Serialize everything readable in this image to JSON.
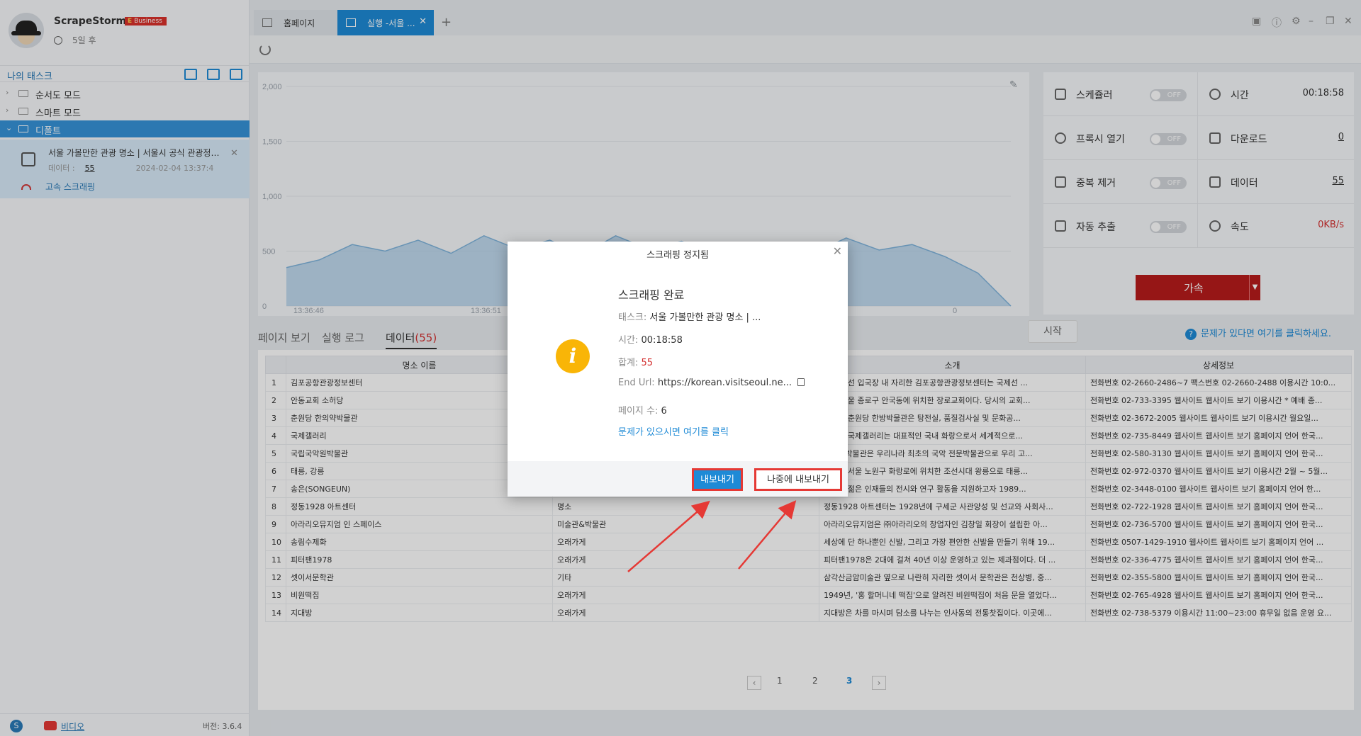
{
  "app": {
    "name": "ScrapeStorm",
    "plan_badge": "Business",
    "plan_badge_prefix": "E",
    "expiry": "5일 후"
  },
  "sidebar": {
    "my_tasks_label": "나의 태스크",
    "tree": [
      {
        "label": "순서도 모드",
        "active": false
      },
      {
        "label": "스마트 모드",
        "active": false
      },
      {
        "label": "디폴트",
        "active": true
      }
    ],
    "task": {
      "title": "서울 가볼만한 관광 명소 | 서울시 공식 관광정보 웹사이트",
      "data_label": "데이터 :",
      "data_count": "55",
      "date": "2024-02-04 13:37:4",
      "speed_label": "고속 스크래핑"
    },
    "footer": {
      "video_label": "비디오",
      "version": "버전: 3.6.4"
    }
  },
  "tabs": [
    {
      "label": "홈페이지"
    },
    {
      "label": "실행 -서울 ..."
    }
  ],
  "chart_data": {
    "type": "area",
    "x": [
      "13:36:46",
      "13:36:51",
      "0"
    ],
    "yticks": [
      0,
      500,
      1000,
      1500,
      2000
    ],
    "ylim": [
      0,
      2000
    ],
    "color": "#a9cde8",
    "values": [
      350,
      420,
      560,
      500,
      600,
      480,
      640,
      520,
      600,
      470,
      640,
      520,
      590,
      480,
      500,
      560,
      480,
      620,
      510,
      560,
      450,
      300,
      0
    ]
  },
  "stats": {
    "scheduler": {
      "label": "스케쥴러",
      "toggle": "OFF"
    },
    "time": {
      "label": "시간",
      "value": "00:18:58"
    },
    "proxy": {
      "label": "프록시 열기",
      "toggle": "OFF"
    },
    "download": {
      "label": "다운로드",
      "value": "0"
    },
    "dedupe": {
      "label": "중복 제거",
      "toggle": "OFF"
    },
    "data": {
      "label": "데이터",
      "value": "55"
    },
    "auto": {
      "label": "자동 추출",
      "toggle": "OFF"
    },
    "speed": {
      "label": "속도",
      "value": "0KB/s"
    },
    "accelerate": "가속"
  },
  "subtabs": {
    "page_view": "페이지 보기",
    "run_log": "실행 로그",
    "data": "데이터",
    "data_count": "(55)"
  },
  "start_button": "시작",
  "help_link": "문제가 있다면 여기를 클릭하세요.",
  "table": {
    "headers": [
      "",
      "명소 이름",
      "",
      "소개",
      "상세정보"
    ],
    "rows": [
      [
        "1",
        "김포공항관광정보센터",
        "",
        "항 국제선 입국장 내 자리한 김포공항관광정보센터는 국제선 ...",
        "전화번호 02-2660-2486~7 팩스번호 02-2660-2488 이용시간 10:0..."
      ],
      [
        "2",
        "안동교회 소허당",
        "",
        "되는 서울 종로구 안국동에 위치한 장로교회이다. 당시의 교회...",
        "전화번호 02-733-3395 웹사이트 웹사이트 보기 이용시간 * 예배 종..."
      ],
      [
        "3",
        "춘원당 한의약박물관",
        "",
        "개관한 춘원당 한방박물관은 탕전실, 품질검사실 및 문화공...",
        "전화번호 02-3672-2005 웹사이트 웹사이트 보기 이용시간 월요일..."
      ],
      [
        "4",
        "국제갤러리",
        "",
        "개관한 국제갤러리는 대표적인 국내 화랑으로서 세계적으로...",
        "전화번호 02-735-8449 웹사이트 웹사이트 보기 홈페이지 언어 한국..."
      ],
      [
        "5",
        "국립국악원박물관",
        "",
        "국악원박물관은 우리나라 최초의 국악 전문박물관으로 우리 고...",
        "전화번호 02-580-3130 웹사이트 웹사이트 보기 홈페이지 언어 한국..."
      ],
      [
        "6",
        "태릉, 강릉",
        "",
        "강릉은 서울 노원구 화랑로에 위치한 조선시대 왕릉으로 태릉...",
        "전화번호 02-972-0370 웹사이트 웹사이트 보기 이용시간 2월 ~ 5월..."
      ],
      [
        "7",
        "송은(SONGEUN)",
        "",
        "미술계 젊은 인재들의 전시와 연구 활동을 지원하고자 1989...",
        "전화번호 02-3448-0100 웹사이트 웹사이트 보기 홈페이지 언어 한..."
      ],
      [
        "8",
        "정동1928 아트센터",
        "명소",
        "정동1928 아트센터는 1928년에 구세군 사관양성 및 선교와 사회사...",
        "전화번호 02-722-1928 웹사이트 웹사이트 보기 홈페이지 언어 한국..."
      ],
      [
        "9",
        "아라리오뮤지엄 인 스페이스",
        "미술관&박물관",
        "아라리오뮤지엄은 ㈜아라리오의 창업자인 김창일 회장이 설립한 아...",
        "전화번호 02-736-5700 웹사이트 웹사이트 보기 홈페이지 언어 한국..."
      ],
      [
        "10",
        "송림수제화",
        "오래가게",
        "세상에 단 하나뿐인 신발, 그리고 가장 편안한 신발을 만들기 위해 19...",
        "전화번호 0507-1429-1910 웹사이트 웹사이트 보기 홈페이지 언어 ..."
      ],
      [
        "11",
        "피터팬1978",
        "오래가게",
        "피터팬1978은 2대에 걸쳐 40년 이상 운영하고 있는 제과점이다. 더 ...",
        "전화번호 02-336-4775 웹사이트 웹사이트 보기 홈페이지 언어 한국..."
      ],
      [
        "12",
        "셋이서문학관",
        "기타",
        "삼각산금암미술관 옆으로 나란히 자리한 셋이서 문학관은 천상병, 중...",
        "전화번호 02-355-5800 웹사이트 웹사이트 보기 홈페이지 언어 한국..."
      ],
      [
        "13",
        "비원떡집",
        "오래가게",
        "1949년, '홍 할머니네 떡집'으로 알려진 비원떡집이 처음 문을 열었다...",
        "전화번호 02-765-4928 웹사이트 웹사이트 보기 홈페이지 언어 한국..."
      ],
      [
        "14",
        "지대방",
        "오래가게",
        "지대방은 차를 마시며 담소를 나누는 인사동의 전통찻집이다. 이곳에...",
        "전화번호 02-738-5379 이용시간 11:00~23:00 휴무일 없음 운영 요..."
      ]
    ]
  },
  "pagination": {
    "pages": [
      "1",
      "2",
      "3"
    ],
    "current": "3"
  },
  "dialog": {
    "title": "스크래핑 정지됨",
    "heading": "스크래핑 완료",
    "task_label": "태스크:",
    "task_value": "서울 가볼만한 관광 명소 | ...",
    "time_label": "시간:",
    "time_value": "00:18:58",
    "total_label": "합계:",
    "total_value": "55",
    "url_label": "End Url:",
    "url_value": "https://korean.visitseoul.ne...",
    "pages_label": "페이지 수:",
    "pages_value": "6",
    "help_link": "문제가 있으시면 여기를 클릭",
    "export_button": "내보내기",
    "later_button": "나중에 내보내기"
  },
  "colors": {
    "accent": "#1e8ad6",
    "highlight": "#e53935",
    "speed_button": "#b71c1c",
    "info_icon": "#f9b507"
  }
}
